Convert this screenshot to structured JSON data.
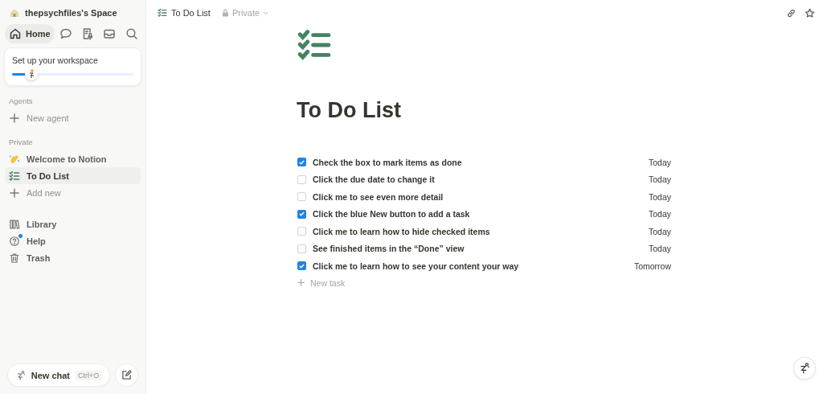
{
  "sidebar": {
    "workspace": "thepsychfiles's Space",
    "nav": [
      {
        "kind": "home",
        "label": "Home",
        "selected": true
      },
      {
        "kind": "chat",
        "selected": false
      },
      {
        "kind": "meeting",
        "selected": false
      },
      {
        "kind": "inbox",
        "selected": false
      }
    ],
    "setup_card": {
      "title": "Set up your workspace",
      "level": 0.16
    },
    "sections": [
      {
        "heading": "Agents",
        "items": [
          {
            "kind": "add",
            "label": "New agent",
            "selected": false
          }
        ]
      },
      {
        "heading": "Private",
        "items": [
          {
            "kind": "wave",
            "label": "Welcome to Notion",
            "selected": false
          },
          {
            "kind": "todo",
            "label": "To Do List",
            "selected": true
          },
          {
            "kind": "add",
            "label": "Add new",
            "selected": false
          }
        ]
      },
      {
        "items": [
          {
            "kind": "library",
            "label": "Library",
            "selected": false
          },
          {
            "kind": "help",
            "label": "Help",
            "selected": false,
            "notification": true
          },
          {
            "kind": "trash",
            "label": "Trash",
            "selected": false
          }
        ]
      }
    ],
    "new_chat": {
      "label": "New chat",
      "shortcut": "Ctrl+O"
    }
  },
  "topbar": {
    "page": "To Do List",
    "privacy": "Private"
  },
  "page": {
    "title": "To Do List",
    "tasks": [
      {
        "label": "Check the box to mark items as done",
        "due": "Today",
        "checked": true
      },
      {
        "label": "Click the due date to change it",
        "due": "Today",
        "checked": false
      },
      {
        "label": "Click me to see even more detail",
        "due": "Today",
        "checked": false
      },
      {
        "label": "Click the blue New button to add a task",
        "due": "Today",
        "checked": true
      },
      {
        "label": "Click me to learn how to hide checked items",
        "due": "Today",
        "checked": false
      },
      {
        "label": "See finished items in the “Done” view",
        "due": "Today",
        "checked": false
      },
      {
        "label": "Click me to learn how to see your content your way",
        "due": "Tomorrow",
        "checked": true
      }
    ],
    "new_task": "New task"
  }
}
